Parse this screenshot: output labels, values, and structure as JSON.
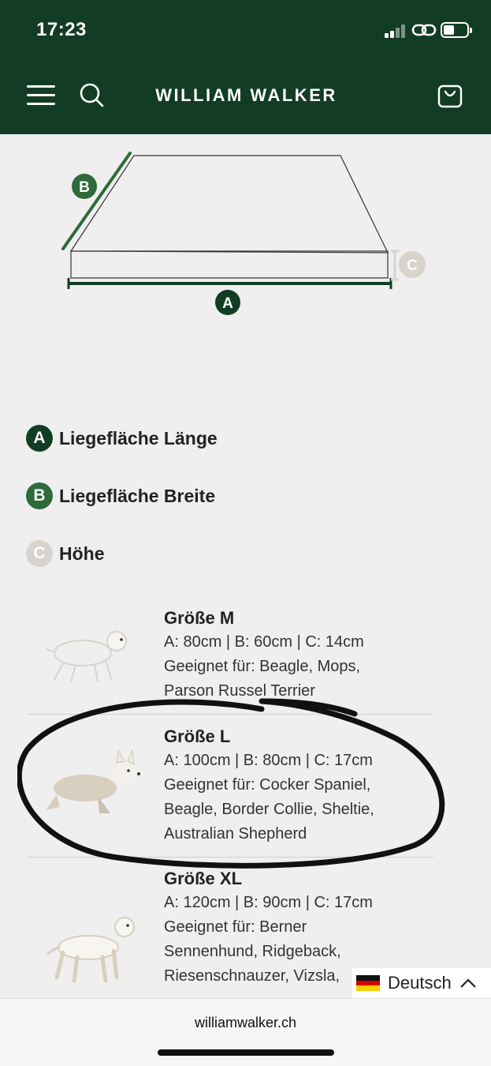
{
  "status": {
    "time": "17:23"
  },
  "header": {
    "brand": "WILLIAM WALKER"
  },
  "diagram": {
    "labels": {
      "a": "A",
      "b": "B",
      "c": "C"
    }
  },
  "legend": [
    {
      "badge": "A",
      "label": "Liegefläche Länge",
      "color": "#123d24"
    },
    {
      "badge": "B",
      "label": "Liegefläche Breite",
      "color": "#2e6a3a"
    },
    {
      "badge": "C",
      "label": "Höhe",
      "color": "#d8d3cc"
    }
  ],
  "sizes": [
    {
      "title": "Größe M",
      "dims": "A: 80cm | B: 60cm | C: 14cm",
      "suitable": [
        "Geeignet für: Beagle, Mops,",
        "Parson Russel Terrier"
      ]
    },
    {
      "title": "Größe L",
      "dims": "A: 100cm | B: 80cm | C: 17cm",
      "suitable": [
        "Geeignet für: Cocker Spaniel,",
        "Beagle, Border Collie, Sheltie,",
        "Australian Shepherd"
      ]
    },
    {
      "title": "Größe XL",
      "dims": "A: 120cm | B: 90cm | C: 17cm",
      "suitable": [
        "Geeignet für: Berner",
        "Sennenhund, Ridgeback,",
        "Riesenschnauzer, Vizsla,"
      ]
    }
  ],
  "language": {
    "label": "Deutsch"
  },
  "browser": {
    "url": "williamwalker.ch"
  },
  "colors": {
    "brand_green": "#123d24",
    "accent_green": "#2e6a3a",
    "beige": "#d8d3cc",
    "background": "#efefef"
  }
}
